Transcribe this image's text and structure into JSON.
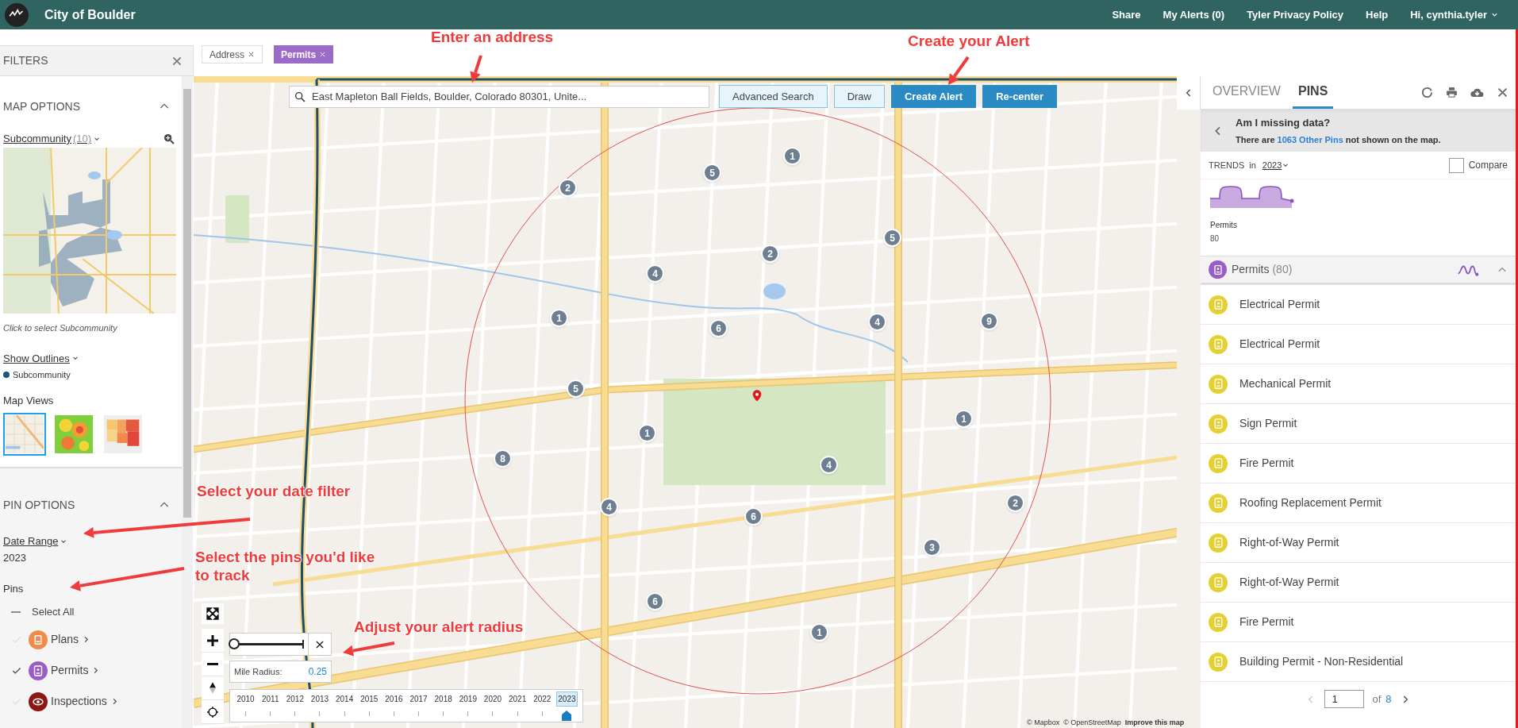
{
  "header": {
    "title": "City of Boulder",
    "nav": [
      "Share",
      "My Alerts (0)",
      "Tyler Privacy Policy",
      "Help"
    ],
    "user_menu": "Hi, cynthia.tyler"
  },
  "filters": {
    "title": "FILTERS",
    "map_options": {
      "title": "MAP OPTIONS",
      "expanded": true,
      "subcommunity": {
        "label": "Subcommunity",
        "count": "(10)"
      },
      "minimap_hint": "Click to select Subcommunity",
      "show_outlines": "Show Outlines",
      "legend": [
        {
          "label": "Subcommunity",
          "color": "#1b5775"
        }
      ],
      "map_views_title": "Map Views",
      "map_views": [
        {
          "kind": "streets",
          "selected": true
        },
        {
          "kind": "heat",
          "selected": false
        },
        {
          "kind": "choropleth",
          "selected": false
        }
      ]
    },
    "pin_options": {
      "title": "PIN OPTIONS",
      "expanded": true,
      "date_range": {
        "label": "Date Range",
        "value": "2023"
      },
      "pins_title": "Pins",
      "select_all": "Select All",
      "layers": [
        {
          "label": "Plans",
          "kind": "plans",
          "checked": false,
          "color": "#f28a4a"
        },
        {
          "label": "Permits",
          "kind": "permits",
          "checked": true,
          "color": "#9a5cc6"
        },
        {
          "label": "Inspections",
          "kind": "inspections",
          "checked": false,
          "color": "#8a1616"
        }
      ]
    }
  },
  "filter_tags": [
    {
      "label": "Address",
      "kind": "plain"
    },
    {
      "label": "Permits",
      "kind": "layer"
    }
  ],
  "map": {
    "search": {
      "value": "East Mapleton Ball Fields, Boulder, Colorado 80301, Unite..."
    },
    "buttons": [
      {
        "label": "Advanced Search",
        "kind": "secondary"
      },
      {
        "label": "Draw",
        "kind": "secondary"
      },
      {
        "label": "Create Alert",
        "kind": "primary"
      },
      {
        "label": "Re-center",
        "kind": "primary"
      }
    ],
    "clusters": [
      "1",
      "5",
      "2",
      "2",
      "5",
      "4",
      "1",
      "6",
      "4",
      "9",
      "5",
      "1",
      "1",
      "8",
      "4",
      "2",
      "4",
      "6",
      "3",
      "6",
      "1"
    ],
    "radius": {
      "level": 0,
      "label": "Mile Radius:",
      "value": "0.25"
    },
    "timeline": [
      {
        "label": "2010",
        "selected": false
      },
      {
        "label": "2011",
        "selected": false
      },
      {
        "label": "2012",
        "selected": false
      },
      {
        "label": "2013",
        "selected": false
      },
      {
        "label": "2014",
        "selected": false
      },
      {
        "label": "2015",
        "selected": false
      },
      {
        "label": "2016",
        "selected": false
      },
      {
        "label": "2017",
        "selected": false
      },
      {
        "label": "2018",
        "selected": false
      },
      {
        "label": "2019",
        "selected": false
      },
      {
        "label": "2020",
        "selected": false
      },
      {
        "label": "2021",
        "selected": false
      },
      {
        "label": "2022",
        "selected": false
      },
      {
        "label": "2023",
        "selected": true
      }
    ],
    "attribution": [
      "© Mapbox",
      "© OpenStreetMap",
      "Improve this map"
    ]
  },
  "panel": {
    "tabs": [
      {
        "label": "OVERVIEW",
        "selected": false
      },
      {
        "label": "PINS",
        "selected": true
      }
    ],
    "notice": {
      "title": "Am I missing data?",
      "prefix": "There are",
      "link": "1063 Other Pins",
      "suffix": "not shown on the map."
    },
    "trends": {
      "label": "TRENDS",
      "in": "in",
      "year": "2023",
      "compare": {
        "label": "Compare",
        "checked": false
      },
      "series_label": "Permits",
      "total": "80"
    },
    "group": {
      "label": "Permits",
      "count": "(80)",
      "expanded": true
    },
    "items": [
      "Electrical Permit",
      "Electrical Permit",
      "Mechanical Permit",
      "Sign Permit",
      "Fire Permit",
      "Roofing Replacement Permit",
      "Right-of-Way Permit",
      "Right-of-Way Permit",
      "Fire Permit",
      "Building Permit - Non-Residential"
    ],
    "pagination": {
      "page": "1",
      "of": "of",
      "total": "8"
    }
  },
  "annotations": [
    "Enter an address",
    "Create your Alert",
    "Select your date filter",
    "Select the pins you'd like to track",
    "Adjust your alert radius"
  ]
}
